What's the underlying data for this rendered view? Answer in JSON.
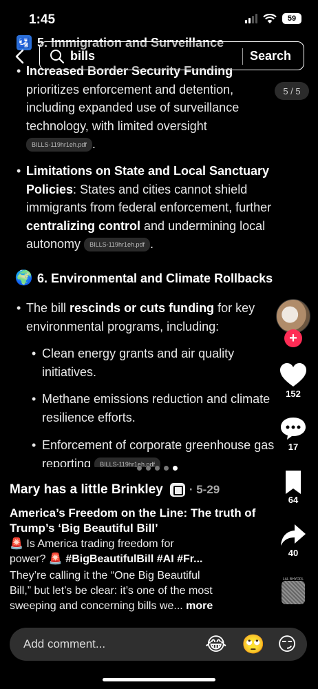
{
  "status": {
    "time": "1:45",
    "battery": "59"
  },
  "search": {
    "query": "bills",
    "button_label": "Search"
  },
  "page_indicator": "5 / 5",
  "content": {
    "section5": {
      "emoji": "🛂",
      "title": "5. Immigration and Surveillance"
    },
    "bullet1": {
      "bold": "Increased Border Security Funding",
      "line2": "prioritizes enforcement and detention,",
      "line3": "including expanded use of surveillance",
      "line4": "technology, with limited oversight",
      "pdf": "BILLS-119hr1eh.pdf"
    },
    "bullet2": {
      "bold1": "Limitations on State and Local Sanctuary",
      "bold2": "Policies",
      "rest2": ": States and cities cannot shield",
      "line3": "immigrants from federal enforcement, further",
      "bold4": "centralizing control",
      "rest4": " and undermining local",
      "line5": "autonomy",
      "pdf": "BILLS-119hr1eh.pdf"
    },
    "section6": {
      "emoji": "🌍",
      "title": "6. Environmental and Climate Rollbacks"
    },
    "bullet3": {
      "pre": "The bill ",
      "bold": "rescinds or cuts funding",
      "post": " for key",
      "line2": "environmental programs, including:"
    },
    "sub1": {
      "line1": "Clean energy grants and air quality",
      "line2": "initiatives."
    },
    "sub2": {
      "line1": "Methane emissions reduction and climate",
      "line2": "resilience efforts."
    },
    "sub3": {
      "line1": "Enforcement of corporate greenhouse gas",
      "line2": "reporting",
      "pdf": "BILLS-119hr1eh.pdf"
    }
  },
  "rail": {
    "likes": "152",
    "comments": "17",
    "saves": "64",
    "shares": "40",
    "music_label": "LAL BHYDDL"
  },
  "post": {
    "author": "Mary has a little Brinkley",
    "date": "· 5-29",
    "title": "America’s Freedom on the Line: The truth of Trump’s ‘Big Beautiful Bill’",
    "line1": "🚨 Is America trading freedom for",
    "line2_pre": "power? 🚨 ",
    "line2_tags": "#BigBeautifulBill #AI #Fr...",
    "line3": "They’re calling it the “One Big Beautiful",
    "line4": "Bill,” but let’s be clear: it’s one of the most",
    "line5": "sweeping and concerning bills we... ",
    "more": "more"
  },
  "comment": {
    "placeholder": "Add comment...",
    "emojis": [
      "😂",
      "🙄",
      "😏"
    ]
  },
  "colors": {
    "background": "#000000",
    "accent": "#fe2c55",
    "comment_bar": "#2f2f2f"
  }
}
